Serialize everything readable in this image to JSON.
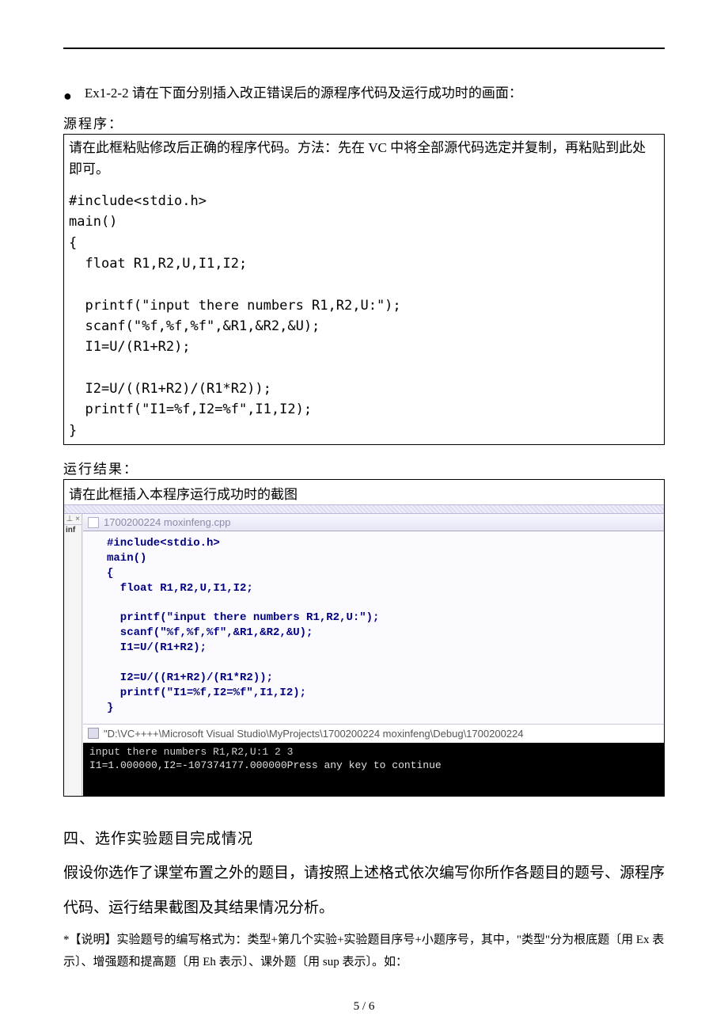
{
  "bullet": {
    "label": "Ex1-2-2 请在下面分别插入改正错误后的源程序代码及运行成功时的画面："
  },
  "source": {
    "label": "源程序：",
    "instruction": "请在此框粘贴修改后正确的程序代码。方法：先在 VC 中将全部源代码选定并复制，再粘贴到此处即可。",
    "code": "#include<stdio.h>\nmain()\n{\n  float R1,R2,U,I1,I2;\n\n  printf(\"input there numbers R1,R2,U:\");\n  scanf(\"%f,%f,%f\",&R1,&R2,&U);\n  I1=U/(R1+R2);\n\n  I2=U/((R1+R2)/(R1*R2));\n  printf(\"I1=%f,I2=%f\",I1,I2);\n}"
  },
  "run": {
    "label": "运行结果：",
    "caption": "请在此框插入本程序运行成功时的截图",
    "gutter1": "⊥ ×",
    "gutter2": "inf",
    "tab": "1700200224 moxinfeng.cpp",
    "ide_code": "#include<stdio.h>\nmain()\n{\n  float R1,R2,U,I1,I2;\n\n  printf(\"input there numbers R1,R2,U:\");\n  scanf(\"%f,%f,%f\",&R1,&R2,&U);\n  I1=U/(R1+R2);\n\n  I2=U/((R1+R2)/(R1*R2));\n  printf(\"I1=%f,I2=%f\",I1,I2);\n}",
    "console_title": "\"D:\\VC++++\\Microsoft Visual Studio\\MyProjects\\1700200224 moxinfeng\\Debug\\1700200224",
    "console_line1": "input there numbers R1,R2,U:1 2 3",
    "console_line2": "I1=1.000000,I2=-107374177.000000Press any key to continue"
  },
  "section4": {
    "heading": "四、选作实验题目完成情况",
    "para": "假设你选作了课堂布置之外的题目，请按照上述格式依次编写你所作各题目的题号、源程序代码、运行结果截图及其结果情况分析。",
    "note": "*【说明】实验题号的编写格式为：类型+第几个实验+实验题目序号+小题序号，其中，\"类型\"分为根底题〔用 Ex 表示〕、增强题和提高题〔用 Eh 表示〕、课外题〔用 sup 表示〕。如："
  },
  "footer": "5 / 6"
}
